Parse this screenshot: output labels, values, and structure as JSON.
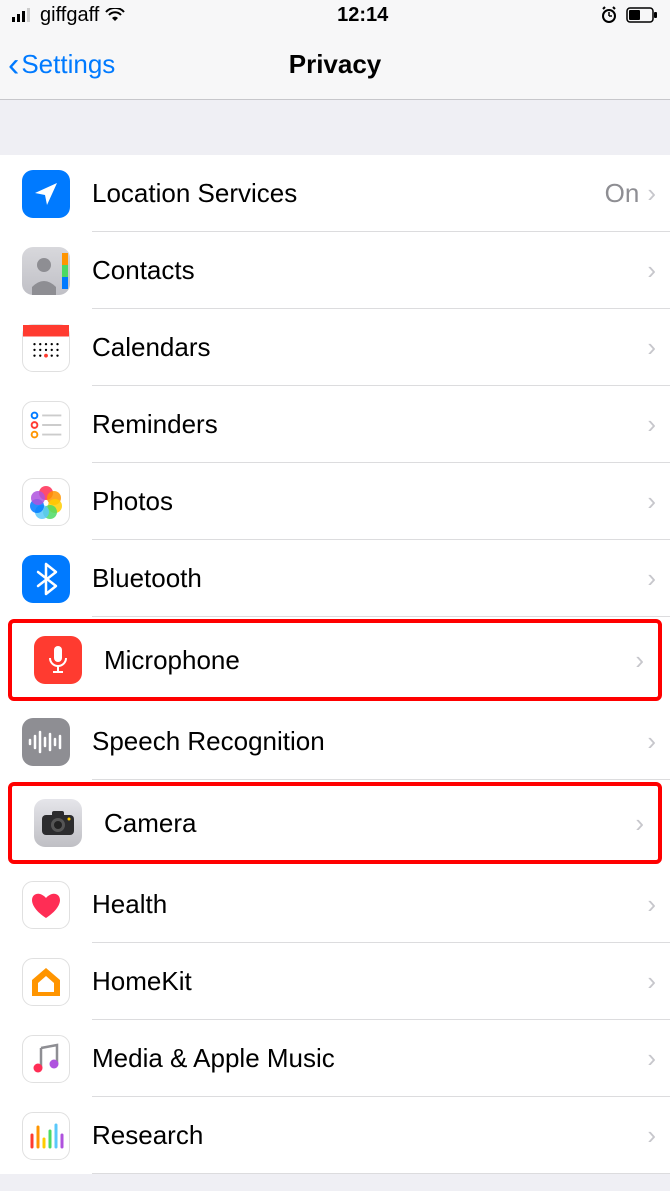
{
  "status": {
    "carrier": "giffgaff",
    "time": "12:14"
  },
  "nav": {
    "back": "Settings",
    "title": "Privacy"
  },
  "rows": [
    {
      "label": "Location Services",
      "value": "On"
    },
    {
      "label": "Contacts"
    },
    {
      "label": "Calendars"
    },
    {
      "label": "Reminders"
    },
    {
      "label": "Photos"
    },
    {
      "label": "Bluetooth"
    },
    {
      "label": "Microphone"
    },
    {
      "label": "Speech Recognition"
    },
    {
      "label": "Camera"
    },
    {
      "label": "Health"
    },
    {
      "label": "HomeKit"
    },
    {
      "label": "Media & Apple Music"
    },
    {
      "label": "Research"
    }
  ]
}
